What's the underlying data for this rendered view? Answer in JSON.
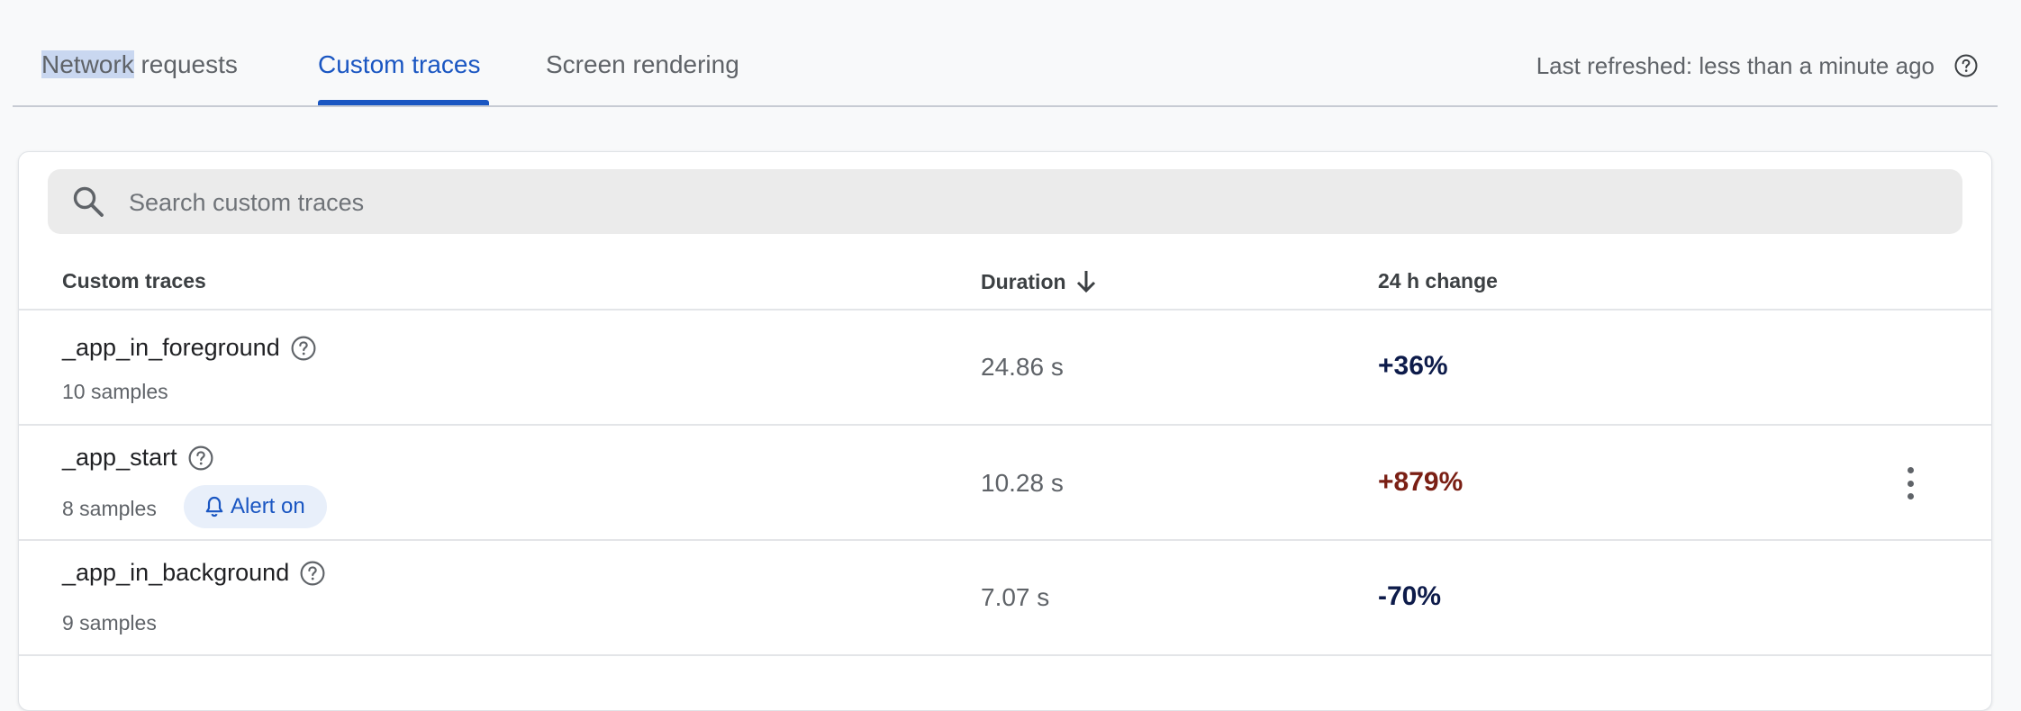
{
  "tabs": [
    {
      "label_selected": "Network",
      "label_rest": " requests"
    },
    {
      "label": "Custom traces"
    },
    {
      "label": "Screen rendering"
    }
  ],
  "refresh": {
    "text": "Last refreshed: less than a minute ago",
    "help_icon": "help-circle-icon"
  },
  "search": {
    "placeholder": "Search custom traces",
    "value": "",
    "icon": "search-icon"
  },
  "table": {
    "headers": {
      "name": "Custom traces",
      "duration": "Duration",
      "change": "24 h change"
    },
    "sort_icon": "arrow-down-icon",
    "rows": [
      {
        "name": "_app_in_foreground",
        "samples": "10 samples",
        "duration": "24.86 s",
        "change": "+36%",
        "change_color": "#0d1b4a",
        "alert": ""
      },
      {
        "name": "_app_start",
        "samples": "8 samples",
        "duration": "10.28 s",
        "change": "+879%",
        "change_color": "#7a1f14",
        "alert": "Alert on"
      },
      {
        "name": "_app_in_background",
        "samples": "9 samples",
        "duration": "7.07 s",
        "change": "-70%",
        "change_color": "#0d1b4a",
        "alert": ""
      }
    ]
  },
  "colors": {
    "accent": "#1a56c2",
    "negative_change": "#7a1f14",
    "neutral_change": "#0d1b4a"
  }
}
